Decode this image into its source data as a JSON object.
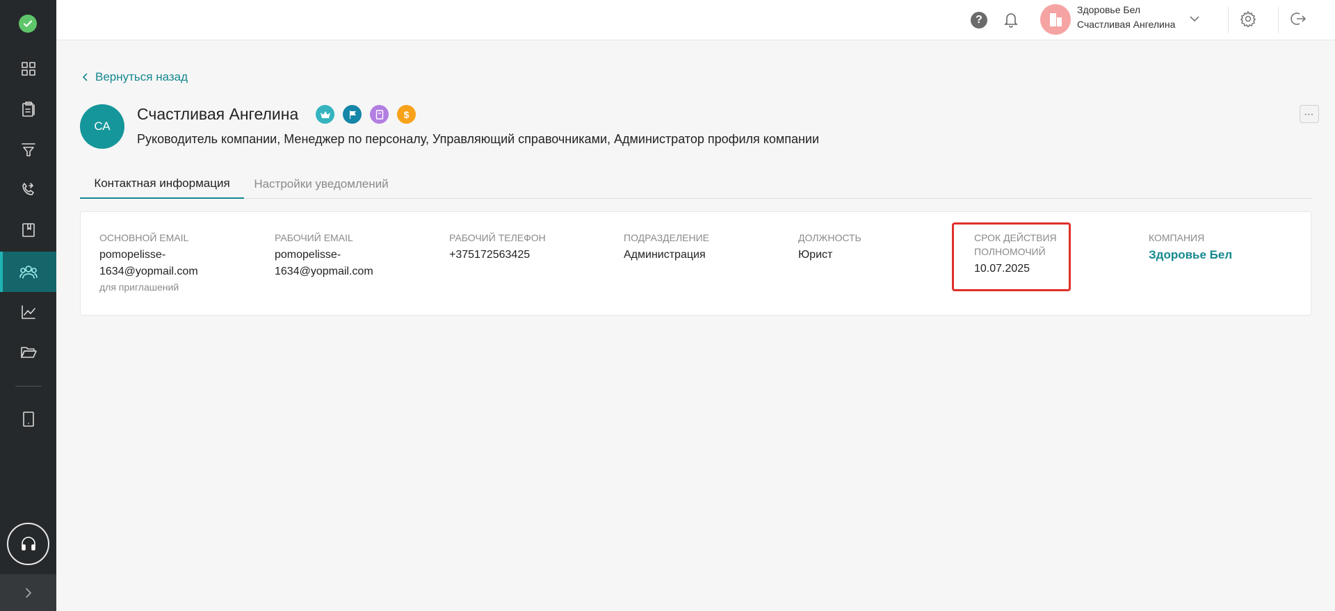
{
  "topbar": {
    "help_icon": "help-icon",
    "bell_icon": "bell-icon",
    "org_name": "Здоровье Бел",
    "user_name": "Счастливая Ангелина",
    "settings_icon": "gear-icon",
    "logout_icon": "logout-icon"
  },
  "sidebar": {
    "items": [
      {
        "icon": "dashboard-icon",
        "active": false
      },
      {
        "icon": "clipboard-icon",
        "active": false
      },
      {
        "icon": "filter-icon",
        "active": false
      },
      {
        "icon": "phone-icon",
        "active": false
      },
      {
        "icon": "book-icon",
        "active": false
      },
      {
        "icon": "users-icon",
        "active": true
      },
      {
        "icon": "chart-icon",
        "active": false
      },
      {
        "icon": "folder-icon",
        "active": false
      },
      {
        "icon": "tablet-icon",
        "active": false
      }
    ],
    "support_icon": "headset-icon",
    "expand_icon": "chevron-right-icon"
  },
  "page": {
    "back_label": "Вернуться назад",
    "avatar_initials": "СА",
    "user_name": "Счастливая Ангелина",
    "badges": [
      {
        "icon": "crown-icon",
        "color": "#35b4bf"
      },
      {
        "icon": "flag-icon",
        "color": "#1585a8"
      },
      {
        "icon": "document-icon",
        "color": "#b27ee0"
      },
      {
        "icon": "dollar-icon",
        "color": "#f7a219"
      }
    ],
    "roles": "Руководитель компании, Менеджер по персоналу, Управляющий справочниками, Администратор профиля компании"
  },
  "tabs": {
    "contact": "Контактная информация",
    "notifications": "Настройки уведомлений"
  },
  "contact": {
    "main_email_label": "Основной Email",
    "main_email_value_line1": "pomopelisse-",
    "main_email_value_line2": "1634@yopmail.com",
    "main_email_hint": "для приглашений",
    "work_email_label": "Рабочий Email",
    "work_email_value_line1": "pomopelisse-",
    "work_email_value_line2": "1634@yopmail.com",
    "work_phone_label": "Рабочий телефон",
    "work_phone_value": "+375172563425",
    "department_label": "Подразделение",
    "department_value": "Администрация",
    "position_label": "Должность",
    "position_value": "Юрист",
    "authority_label_line1": "Срок действия",
    "authority_label_line2": "полномочий",
    "authority_value": "10.07.2025",
    "company_label": "Компания",
    "company_value": "Здоровье Бел"
  },
  "colors": {
    "accent": "#14888f",
    "sidebar_bg": "#26292b",
    "highlight": "#e0302b"
  }
}
